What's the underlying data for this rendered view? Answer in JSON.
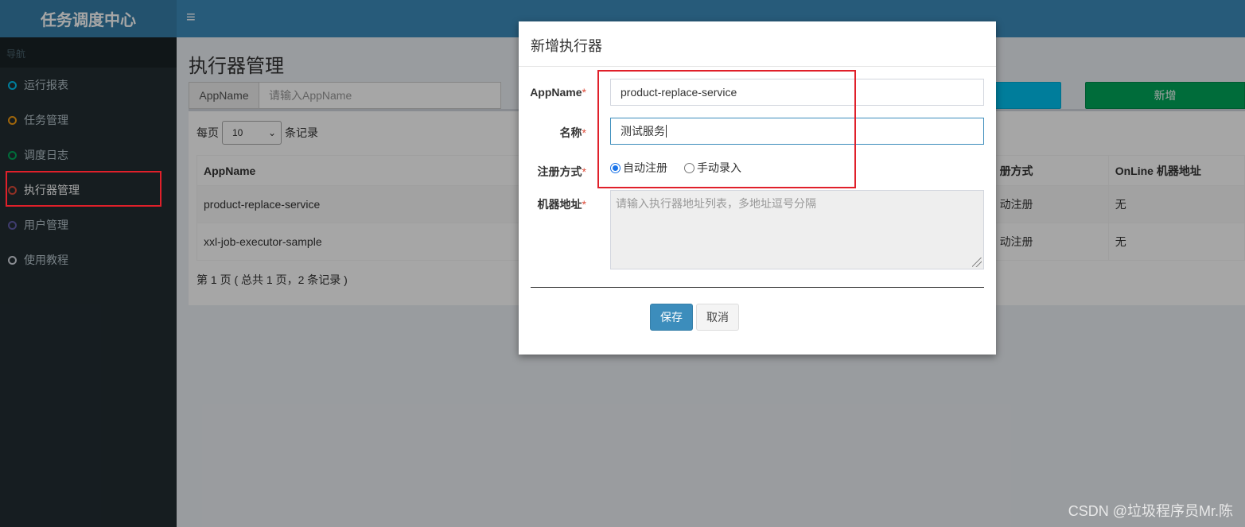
{
  "app": {
    "title": "任务调度中心"
  },
  "sidebar": {
    "header": "导航",
    "items": [
      {
        "label": "运行报表",
        "color": "#00c0ef"
      },
      {
        "label": "任务管理",
        "color": "#f39c12"
      },
      {
        "label": "调度日志",
        "color": "#00a65a"
      },
      {
        "label": "执行器管理",
        "color": "#dd4b39"
      },
      {
        "label": "用户管理",
        "color": "#605ca8"
      },
      {
        "label": "使用教程",
        "color": "#d2d6de"
      }
    ],
    "active_index": 3
  },
  "header": {
    "menu_icon": "hamburger-icon"
  },
  "page": {
    "title": "执行器管理",
    "filter": {
      "label": "AppName",
      "placeholder": "请输入AppName"
    },
    "add_button": "新增",
    "length": {
      "prefix": "每页",
      "value": "10",
      "suffix": "条记录"
    },
    "table": {
      "columns": [
        "AppName",
        "",
        "册方式",
        "OnLine 机器地址"
      ],
      "rows": [
        [
          "product-replace-service",
          "",
          "动注册",
          "无"
        ],
        [
          "xxl-job-executor-sample",
          "",
          "动注册",
          "无"
        ]
      ]
    },
    "info": "第 1 页 ( 总共 1 页，2 条记录 )"
  },
  "modal": {
    "title": "新增执行器",
    "fields": {
      "appname_label": "AppName",
      "appname_value": "product-replace-service",
      "name_label": "名称",
      "name_value": "测试服务",
      "reg_label": "注册方式",
      "reg_auto": "自动注册",
      "reg_manual": "手动录入",
      "addr_label": "机器地址",
      "addr_placeholder": "请输入执行器地址列表，多地址逗号分隔",
      "required_mark": "*"
    },
    "save": "保存",
    "cancel": "取消"
  },
  "watermark": "CSDN @垃圾程序员Mr.陈"
}
